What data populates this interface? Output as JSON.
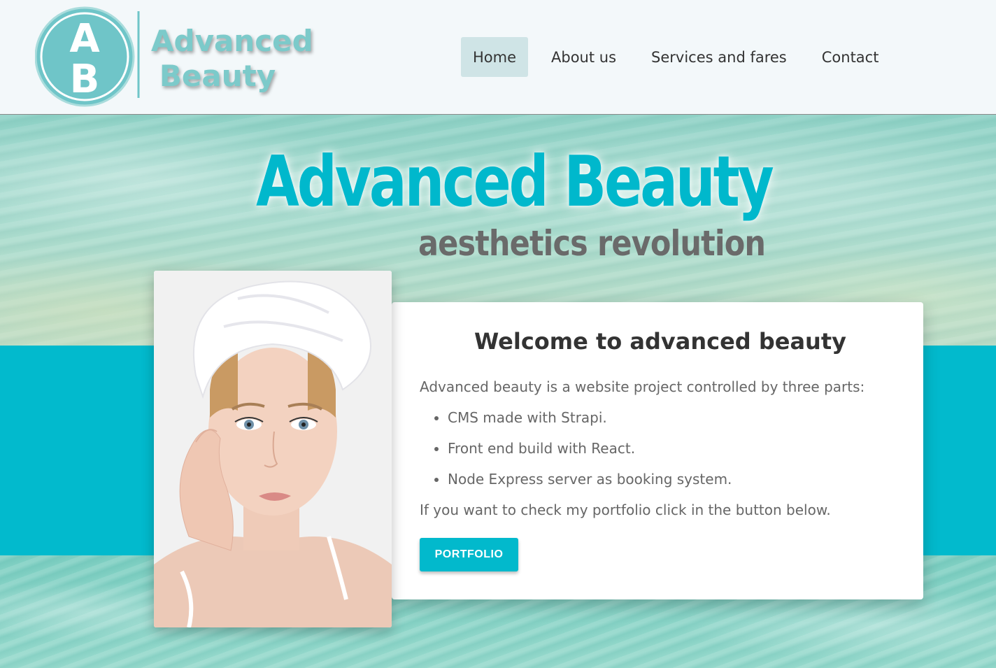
{
  "header": {
    "logo": {
      "monogram_top": "A",
      "monogram_bottom": "B",
      "line1": "Advanced",
      "line2": "Beauty"
    },
    "nav": [
      {
        "label": "Home",
        "active": true
      },
      {
        "label": "About us",
        "active": false
      },
      {
        "label": "Services and fares",
        "active": false
      },
      {
        "label": "Contact",
        "active": false
      }
    ]
  },
  "hero": {
    "title": "Advanced Beauty",
    "subtitle": "aesthetics revolution"
  },
  "card": {
    "title": "Welcome to advanced beauty",
    "intro": "Advanced beauty is a website project controlled by three parts:",
    "items": [
      "CMS made with Strapi.",
      "Front end build with React.",
      "Node Express server as booking system."
    ],
    "outro": "If you want to check my portfolio click in the button below.",
    "button_label": "PORTFOLIO"
  },
  "colors": {
    "accent": "#02bacd",
    "nav_active_bg": "#cfe4e6",
    "logo": "#7ccaca"
  }
}
